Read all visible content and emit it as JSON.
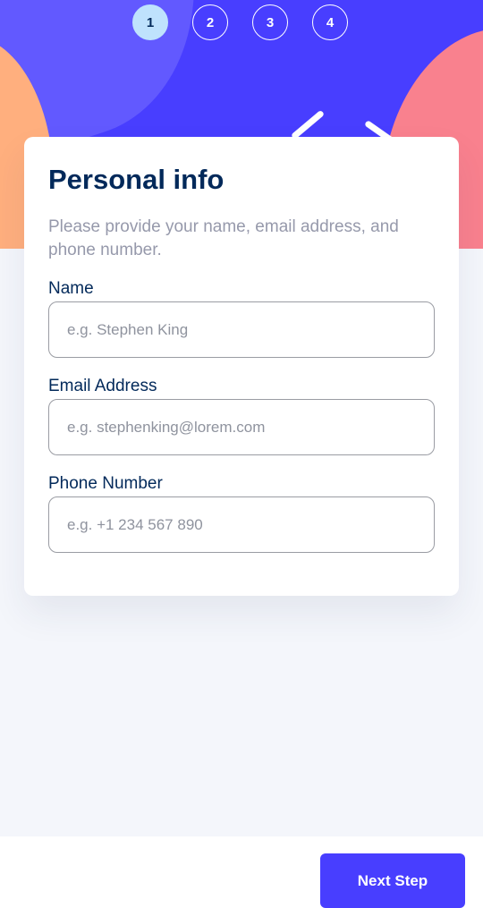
{
  "steps": [
    {
      "number": "1",
      "active": true
    },
    {
      "number": "2",
      "active": false
    },
    {
      "number": "3",
      "active": false
    },
    {
      "number": "4",
      "active": false
    }
  ],
  "card": {
    "title": "Personal info",
    "subtitle": "Please provide your name, email address, and phone number."
  },
  "form": {
    "name": {
      "label": "Name",
      "placeholder": "e.g. Stephen King",
      "value": ""
    },
    "email": {
      "label": "Email Address",
      "placeholder": "e.g. stephenking@lorem.com",
      "value": ""
    },
    "phone": {
      "label": "Phone Number",
      "placeholder": "e.g. +1 234 567 890",
      "value": ""
    }
  },
  "footer": {
    "next_label": "Next Step"
  },
  "colors": {
    "primary": "#483eff",
    "primary_light": "#6259ff",
    "text_dark": "#02295a",
    "text_muted": "#9699ab",
    "step_active_bg": "#bfe2fd",
    "accent_orange": "#ffaf7e",
    "accent_pink": "#f9818e",
    "page_bg": "#f4f6fb"
  }
}
